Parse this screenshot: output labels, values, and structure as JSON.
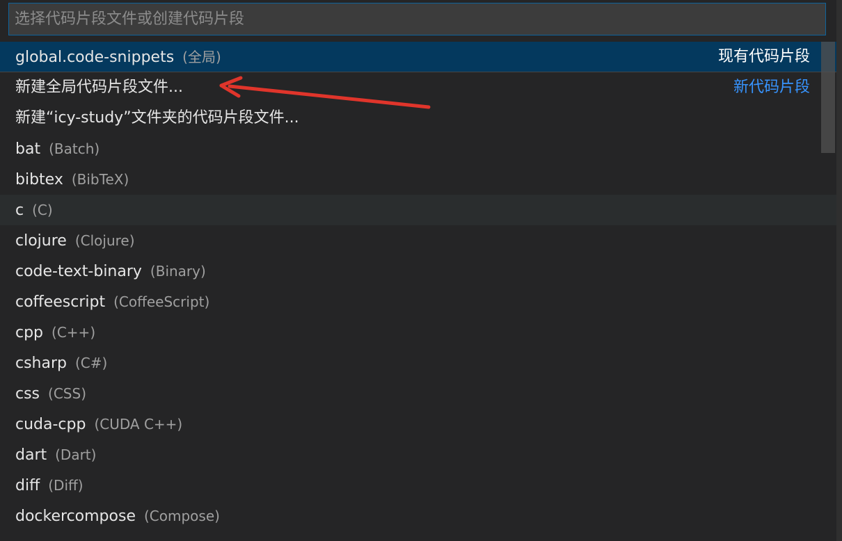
{
  "search": {
    "placeholder": "选择代码片段文件或创建代码片段"
  },
  "items": [
    {
      "label": "global.code-snippets",
      "description": "(全局)",
      "right_label": "现有代码片段",
      "state": "selected"
    },
    {
      "label": "新建全局代码片段文件...",
      "description": "",
      "right_label": "新代码片段",
      "state": ""
    },
    {
      "label": "新建“icy-study”文件夹的代码片段文件...",
      "description": "",
      "right_label": "",
      "state": ""
    },
    {
      "label": "bat",
      "description": "(Batch)",
      "right_label": "",
      "state": ""
    },
    {
      "label": "bibtex",
      "description": "(BibTeX)",
      "right_label": "",
      "state": ""
    },
    {
      "label": "c",
      "description": "(C)",
      "right_label": "",
      "state": "hovered"
    },
    {
      "label": "clojure",
      "description": "(Clojure)",
      "right_label": "",
      "state": ""
    },
    {
      "label": "code-text-binary",
      "description": "(Binary)",
      "right_label": "",
      "state": ""
    },
    {
      "label": "coffeescript",
      "description": "(CoffeeScript)",
      "right_label": "",
      "state": ""
    },
    {
      "label": "cpp",
      "description": "(C++)",
      "right_label": "",
      "state": ""
    },
    {
      "label": "csharp",
      "description": "(C#)",
      "right_label": "",
      "state": ""
    },
    {
      "label": "css",
      "description": "(CSS)",
      "right_label": "",
      "state": ""
    },
    {
      "label": "cuda-cpp",
      "description": "(CUDA C++)",
      "right_label": "",
      "state": ""
    },
    {
      "label": "dart",
      "description": "(Dart)",
      "right_label": "",
      "state": ""
    },
    {
      "label": "diff",
      "description": "(Diff)",
      "right_label": "",
      "state": ""
    },
    {
      "label": "dockercompose",
      "description": "(Compose)",
      "right_label": "",
      "state": ""
    }
  ],
  "colors": {
    "selected_bg": "#04395e",
    "focus_border": "#0e639c",
    "new_snippet_link": "#3794ff",
    "annotation_arrow": "#e0352b"
  }
}
